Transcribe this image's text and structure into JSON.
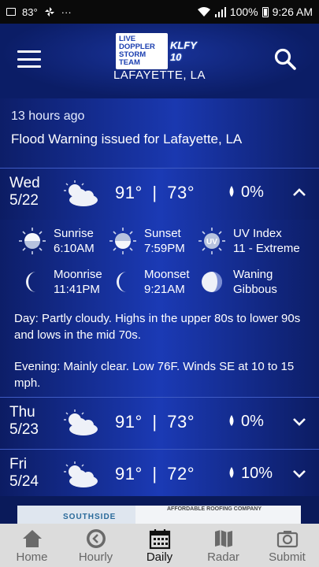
{
  "status_bar": {
    "temp": "83°",
    "more": "···",
    "battery": "100%",
    "time": "9:26 AM"
  },
  "header": {
    "logo_line1": "LIVE DOPPLER",
    "logo_line2": "STORM TEAM",
    "logo_station": "KLFY 10",
    "location": "LAFAYETTE, LA"
  },
  "alert": {
    "time": "13 hours ago",
    "text": "Flood Warning issued for Lafayette, LA"
  },
  "days": [
    {
      "day": "Wed",
      "date": "5/22",
      "icon": "partly-cloudy-icon",
      "high": "91°",
      "low": "73°",
      "sep": "|",
      "precip": "0%",
      "expanded": true
    },
    {
      "day": "Thu",
      "date": "5/23",
      "icon": "partly-cloudy-icon",
      "high": "91°",
      "low": "73°",
      "sep": "|",
      "precip": "0%",
      "expanded": false
    },
    {
      "day": "Fri",
      "date": "5/24",
      "icon": "partly-cloudy-icon",
      "high": "91°",
      "low": "72°",
      "sep": "|",
      "precip": "10%",
      "expanded": false
    }
  ],
  "details": {
    "sunrise": {
      "label": "Sunrise",
      "value": "6:10AM"
    },
    "sunset": {
      "label": "Sunset",
      "value": "7:59PM"
    },
    "uv": {
      "label": "UV Index",
      "value": "11 - Extreme",
      "icon_text": "UV"
    },
    "moonrise": {
      "label": "Moonrise",
      "value": "11:41PM"
    },
    "moonset": {
      "label": "Moonset",
      "value": "9:21AM"
    },
    "moon_phase": {
      "line1": "Waning",
      "line2": "Gibbous"
    },
    "day_desc": "Day: Partly cloudy. Highs in the upper 80s to lower 90s and lows in the mid 70s.",
    "evening_desc": "Evening: Mainly clear. Low 76F. Winds SE at 10 to 15 mph."
  },
  "ad": {
    "left_text": "SOUTHSIDE",
    "right_text": "AFFORDABLE ROOFING COMPANY"
  },
  "nav": [
    {
      "label": "Home",
      "icon": "home-icon"
    },
    {
      "label": "Hourly",
      "icon": "clock-icon"
    },
    {
      "label": "Daily",
      "icon": "calendar-icon",
      "active": true
    },
    {
      "label": "Radar",
      "icon": "map-icon"
    },
    {
      "label": "Submit",
      "icon": "camera-icon"
    }
  ]
}
